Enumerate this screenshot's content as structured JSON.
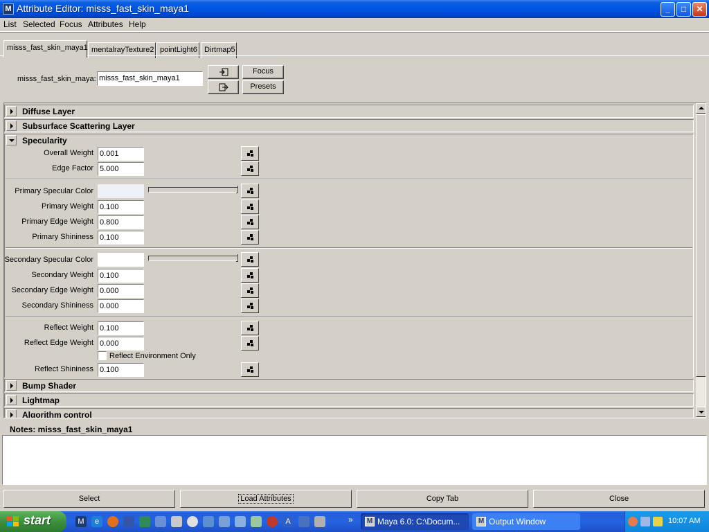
{
  "window": {
    "title": "Attribute Editor: misss_fast_skin_maya1",
    "app_icon": "M",
    "controls": {
      "minimize": "_",
      "maximize": "□",
      "close": "✕"
    }
  },
  "menu": [
    "List",
    "Selected",
    "Focus",
    "Attributes",
    "Help"
  ],
  "tabs": [
    "misss_fast_skin_maya1",
    "mentalrayTexture2",
    "pointLight6",
    "Dirtmap5"
  ],
  "active_tab": 0,
  "node": {
    "label": "misss_fast_skin_maya:",
    "value": "misss_fast_skin_maya1",
    "focus_label": "Focus",
    "presets_label": "Presets"
  },
  "frames": {
    "diffuse": "Diffuse Layer",
    "subsurface": "Subsurface Scattering Layer",
    "specularity": "Specularity",
    "bump": "Bump Shader",
    "lightmap": "Lightmap",
    "algorithm": "Algorithm control"
  },
  "specularity": {
    "overall_weight": {
      "label": "Overall Weight",
      "value": "0.001"
    },
    "edge_factor": {
      "label": "Edge Factor",
      "value": "5.000"
    },
    "primary_color": {
      "label": "Primary Specular Color",
      "color": "#eef1f8",
      "slider": 1.0
    },
    "primary_weight": {
      "label": "Primary Weight",
      "value": "0.100"
    },
    "primary_edge_weight": {
      "label": "Primary Edge Weight",
      "value": "0.800"
    },
    "primary_shininess": {
      "label": "Primary Shininess",
      "value": "0.100"
    },
    "secondary_color": {
      "label": "Secondary Specular Color",
      "color": "#ffffff",
      "slider": 1.0
    },
    "secondary_weight": {
      "label": "Secondary Weight",
      "value": "0.100"
    },
    "secondary_edge_weight": {
      "label": "Secondary Edge Weight",
      "value": "0.000"
    },
    "secondary_shininess": {
      "label": "Secondary Shininess",
      "value": "0.000"
    },
    "reflect_weight": {
      "label": "Reflect Weight",
      "value": "0.100"
    },
    "reflect_edge_weight": {
      "label": "Reflect Edge Weight",
      "value": "0.000"
    },
    "reflect_env_only": {
      "label": "Reflect Environment Only",
      "checked": false
    },
    "reflect_shininess": {
      "label": "Reflect Shininess",
      "value": "0.100"
    }
  },
  "notes": {
    "label": "Notes:  misss_fast_skin_maya1",
    "value": ""
  },
  "buttons": {
    "select": "Select",
    "load": "Load Attributes",
    "copy_tab": "Copy Tab",
    "close": "Close"
  },
  "taskbar": {
    "start": "start",
    "tasks": [
      "Maya 6.0: C:\\Docum...",
      "Output Window"
    ],
    "clock": "10:07 AM",
    "more": "»"
  },
  "colors": {
    "panel": "#d4d0c8",
    "titlebar": "#0054e3",
    "taskbar": "#245edb",
    "start": "#3c8f3c"
  }
}
